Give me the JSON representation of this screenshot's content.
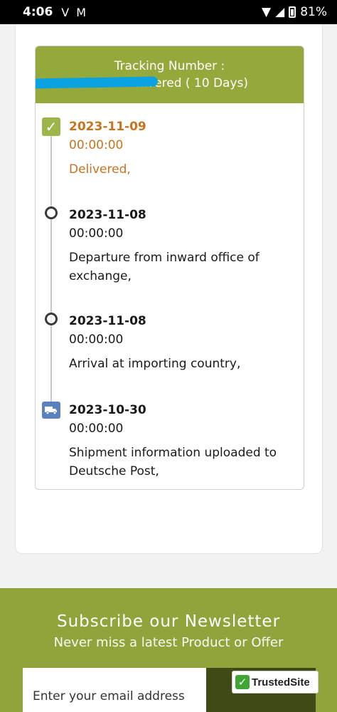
{
  "status_bar": {
    "time": "4:06",
    "battery": "81%"
  },
  "tracking": {
    "header_label": "Tracking Number :",
    "status_visible": "E Delivered ( 10 Days)",
    "events": [
      {
        "date": "2023-11-09",
        "time": "00:00:00",
        "description": "Delivered,",
        "icon": "check-icon"
      },
      {
        "date": "2023-11-08",
        "time": "00:00:00",
        "description": "Departure from inward office of exchange,",
        "icon": "circle-icon"
      },
      {
        "date": "2023-11-08",
        "time": "00:00:00",
        "description": "Arrival at importing country,",
        "icon": "circle-icon"
      },
      {
        "date": "2023-10-30",
        "time": "00:00:00",
        "description": "Shipment information uploaded to Deutsche Post,",
        "icon": "truck-icon"
      }
    ]
  },
  "newsletter": {
    "title": "Subscribe our Newsletter",
    "subtitle": "Never miss a latest Product or Offer",
    "email_placeholder": "Enter your email address"
  },
  "trusted_badge": {
    "label": "TrustedSite"
  },
  "colors": {
    "brand_green": "#95a83c",
    "delivered_orange": "#c8731f",
    "redaction_blue": "#0aa2e0",
    "truck_blue": "#5a82c0"
  }
}
